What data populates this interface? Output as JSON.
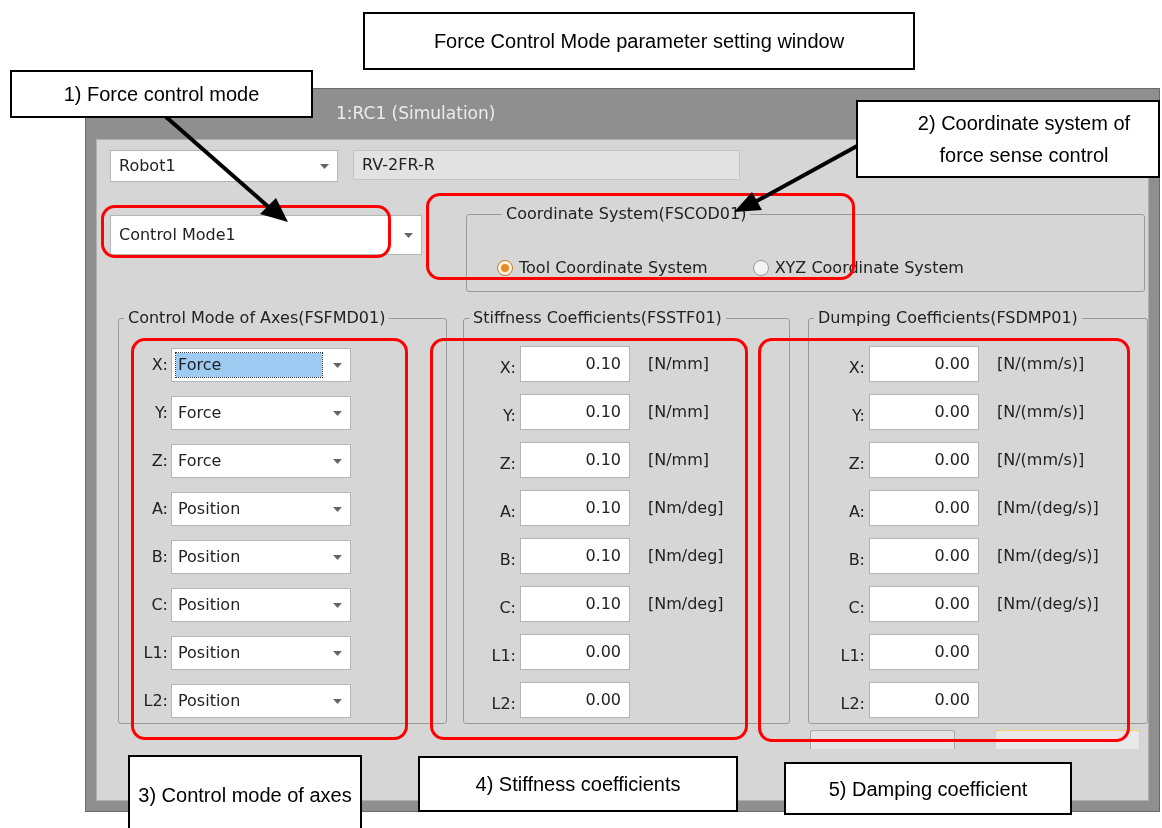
{
  "window": {
    "title": "1:RC1  (Simulation)"
  },
  "robot": {
    "value": "Robot1",
    "model": "RV-2FR-R"
  },
  "control_mode": {
    "value": "Control Mode1"
  },
  "coordinate_system": {
    "legend": "Coordinate System(FSCOD01)",
    "options": [
      {
        "label": "Tool Coordinate System",
        "selected": true
      },
      {
        "label": "XYZ Coordinate System",
        "selected": false
      }
    ]
  },
  "axes": {
    "legend": "Control Mode of Axes(FSFMD01)",
    "rows": [
      {
        "label": "X:",
        "value": "Force",
        "selected": true
      },
      {
        "label": "Y:",
        "value": "Force",
        "selected": false
      },
      {
        "label": "Z:",
        "value": "Force",
        "selected": false
      },
      {
        "label": "A:",
        "value": "Position",
        "selected": false
      },
      {
        "label": "B:",
        "value": "Position",
        "selected": false
      },
      {
        "label": "C:",
        "value": "Position",
        "selected": false
      },
      {
        "label": "L1:",
        "value": "Position",
        "selected": false
      },
      {
        "label": "L2:",
        "value": "Position",
        "selected": false
      }
    ]
  },
  "stiffness": {
    "legend": "Stiffness Coefficients(FSSTF01)",
    "rows": [
      {
        "label": "X:",
        "value": "0.10",
        "unit": "[N/mm]"
      },
      {
        "label": "Y:",
        "value": "0.10",
        "unit": "[N/mm]"
      },
      {
        "label": "Z:",
        "value": "0.10",
        "unit": "[N/mm]"
      },
      {
        "label": "A:",
        "value": "0.10",
        "unit": "[Nm/deg]"
      },
      {
        "label": "B:",
        "value": "0.10",
        "unit": "[Nm/deg]"
      },
      {
        "label": "C:",
        "value": "0.10",
        "unit": "[Nm/deg]"
      },
      {
        "label": "L1:",
        "value": "0.00"
      },
      {
        "label": "L2:",
        "value": "0.00"
      }
    ]
  },
  "damping": {
    "legend": "Dumping Coefficients(FSDMP01)",
    "rows": [
      {
        "label": "X:",
        "value": "0.00",
        "unit": "[N/(mm/s)]"
      },
      {
        "label": "Y:",
        "value": "0.00",
        "unit": "[N/(mm/s)]"
      },
      {
        "label": "Z:",
        "value": "0.00",
        "unit": "[N/(mm/s)]"
      },
      {
        "label": "A:",
        "value": "0.00",
        "unit": "[Nm/(deg/s)]"
      },
      {
        "label": "B:",
        "value": "0.00",
        "unit": "[Nm/(deg/s)]"
      },
      {
        "label": "C:",
        "value": "0.00",
        "unit": "[Nm/(deg/s)]"
      },
      {
        "label": "L1:",
        "value": "0.00"
      },
      {
        "label": "L2:",
        "value": "0.00"
      }
    ]
  },
  "annotations": [
    {
      "text": "Force Control Mode parameter setting window"
    },
    {
      "text": "1) Force control mode"
    },
    {
      "text": "2) Coordinate system of force sense control"
    },
    {
      "text": "3) Control mode of axes"
    },
    {
      "text": "4) Stiffness coefficients"
    },
    {
      "text": "5) Damping coefficient"
    }
  ]
}
